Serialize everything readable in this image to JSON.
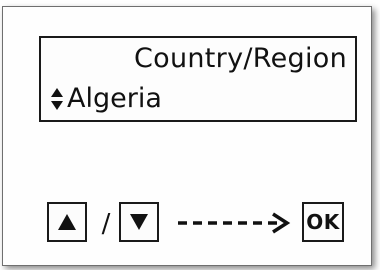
{
  "display": {
    "title": "Country/Region",
    "value": "Algeria",
    "value_icon": "updown-arrows-icon"
  },
  "keys": {
    "up_icon": "triangle-up-icon",
    "separator": "/",
    "down_icon": "triangle-down-icon",
    "flow_icon": "dashed-arrow-right-icon",
    "ok_label": "OK"
  },
  "colors": {
    "ink": "#111111",
    "background": "#ffffff"
  }
}
